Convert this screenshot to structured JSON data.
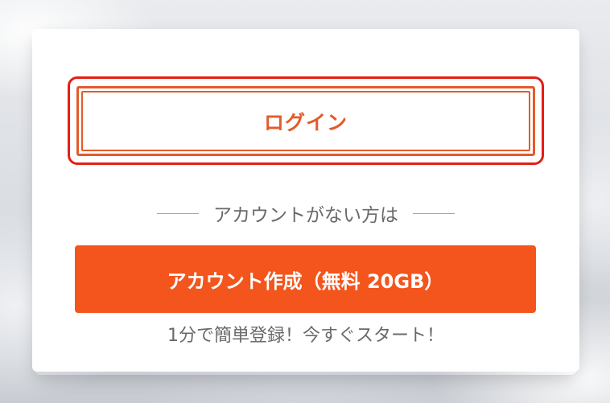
{
  "login": {
    "label": "ログイン"
  },
  "divider": {
    "text": "アカウントがない方は"
  },
  "create_account": {
    "label": "アカウント作成（無料 20GB）"
  },
  "subtext": "1分で簡単登録！今すぐスタート！",
  "colors": {
    "accent": "#f3551d",
    "login_border": "#e35b2b",
    "highlight": "#e51e14",
    "secondary_text": "#6a6a6a"
  }
}
